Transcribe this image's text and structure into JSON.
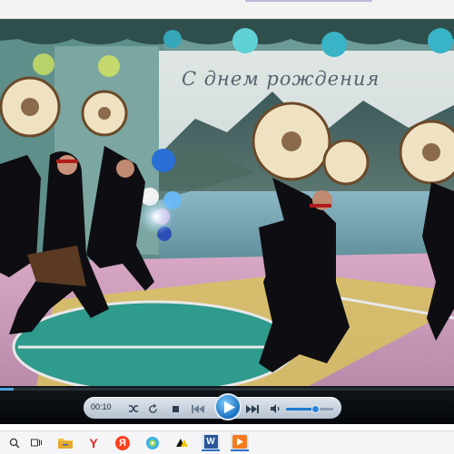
{
  "browser_strip": {},
  "video": {
    "overlay_text": "С днем рождения"
  },
  "controls": {
    "time": "00:10",
    "progress": 0.03,
    "volume": 0.62,
    "icons": {
      "shuffle": "shuffle-icon",
      "repeat": "repeat-icon",
      "stop": "stop-icon",
      "previous": "previous-icon",
      "play": "play-icon",
      "next": "next-icon",
      "volume": "speaker-icon"
    }
  },
  "taskbar": {
    "items": [
      {
        "name": "search-icon"
      },
      {
        "name": "task-view-icon"
      },
      {
        "name": "file-explorer-icon"
      },
      {
        "name": "yandex-icon",
        "label": "Y"
      },
      {
        "name": "yandex-browser-icon",
        "label": "Я"
      },
      {
        "name": "media-center-icon"
      },
      {
        "name": "beeline-icon"
      },
      {
        "name": "word-icon",
        "label": "W"
      },
      {
        "name": "media-player-icon"
      }
    ]
  },
  "colors": {
    "accent": "#1a6fc0",
    "floor": "#c79ab8",
    "court_circle": "#2f9a8b",
    "taskbar_bg": "#f5f5f7"
  }
}
